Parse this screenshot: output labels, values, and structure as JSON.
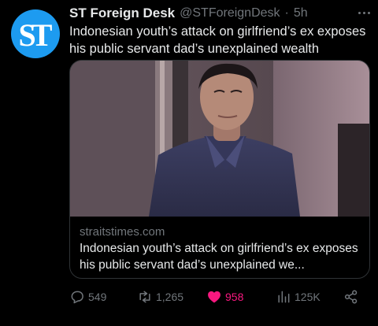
{
  "author": {
    "display_name": "ST Foreign Desk",
    "handle": "@STForeignDesk",
    "separator": "·",
    "time": "5h",
    "avatar_text": "ST"
  },
  "tweet_text": "Indonesian youth’s attack on girlfriend’s ex exposes his public servant dad’s unexplained wealth",
  "card": {
    "domain": "straitstimes.com",
    "title": "Indonesian youth’s attack on girlfriend’s ex exposes his public servant dad’s unexplained we..."
  },
  "metrics": {
    "replies": "549",
    "retweets": "1,265",
    "likes": "958",
    "views": "125K"
  },
  "colors": {
    "background": "#000000",
    "accent": "#1d9bf0",
    "like": "#f91880",
    "muted": "#71767b"
  },
  "icons": [
    "more-icon",
    "reply-icon",
    "retweet-icon",
    "like-icon",
    "views-icon",
    "share-icon"
  ]
}
